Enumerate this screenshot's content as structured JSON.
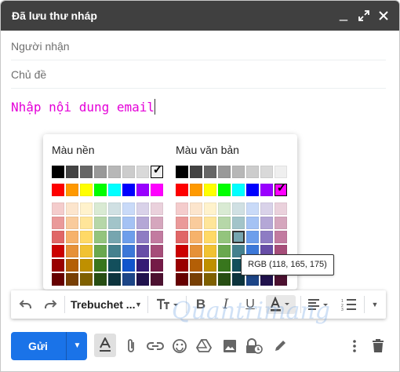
{
  "window": {
    "title": "Đã lưu thư nháp"
  },
  "fields": {
    "to_placeholder": "Người nhận",
    "subject_placeholder": "Chủ đề"
  },
  "body": {
    "text": "Nhập nội dung email",
    "text_color": "#e400d8"
  },
  "palette": {
    "background_title": "Màu nền",
    "text_title": "Màu văn bản",
    "gray_row": [
      "#000000",
      "#434343",
      "#666666",
      "#999999",
      "#b7b7b7",
      "#cccccc",
      "#d9d9d9",
      "#efefef",
      "#f3f3f3",
      "#ffffff"
    ],
    "bright_row": [
      "#ff0000",
      "#ff9900",
      "#ffff00",
      "#00ff00",
      "#00ffff",
      "#0000ff",
      "#9900ff",
      "#ff00ff"
    ],
    "shade_rows": [
      [
        "#f4cccc",
        "#fce5cd",
        "#fff2cc",
        "#d9ead3",
        "#d0e0e3",
        "#c9daf8",
        "#d9d2e9",
        "#ead1dc"
      ],
      [
        "#ea9999",
        "#f9cb9c",
        "#ffe599",
        "#b6d7a8",
        "#a2c4c9",
        "#a4c2f4",
        "#b4a7d6",
        "#d5a6bd"
      ],
      [
        "#e06666",
        "#f6b26b",
        "#ffd966",
        "#93c47d",
        "#76a5af",
        "#6d9eeb",
        "#8e7cc3",
        "#c27ba0"
      ],
      [
        "#cc0000",
        "#e69138",
        "#f1c232",
        "#6aa84f",
        "#45818e",
        "#3c78d8",
        "#674ea7",
        "#a64d79"
      ],
      [
        "#990000",
        "#b45f06",
        "#bf9000",
        "#38761d",
        "#134f5c",
        "#1155cc",
        "#351c75",
        "#741b47"
      ],
      [
        "#660000",
        "#783f04",
        "#7f6000",
        "#274e13",
        "#0c343d",
        "#1c4587",
        "#20124d",
        "#4c1130"
      ]
    ],
    "check_glyph": "✓"
  },
  "tooltip": "RGB (118, 165, 175)",
  "format_toolbar": {
    "font_label": "Trebuchet ...",
    "items": [
      "undo-icon",
      "redo-icon",
      "font-size-icon",
      "bold-icon",
      "italic-icon",
      "underline-icon",
      "text-color-icon",
      "align-icon",
      "numbered-list-icon",
      "more-formatting-icon"
    ]
  },
  "bottom_bar": {
    "send_label": "Gửi",
    "items": [
      "formatting-options-icon",
      "attach-file-icon",
      "insert-link-icon",
      "insert-emoji-icon",
      "google-drive-icon",
      "insert-photo-icon",
      "confidential-mode-icon",
      "signature-icon",
      "more-options-icon",
      "discard-draft-icon"
    ]
  },
  "colors": {
    "accent": "#1a73e8",
    "title_bar": "#404040"
  }
}
